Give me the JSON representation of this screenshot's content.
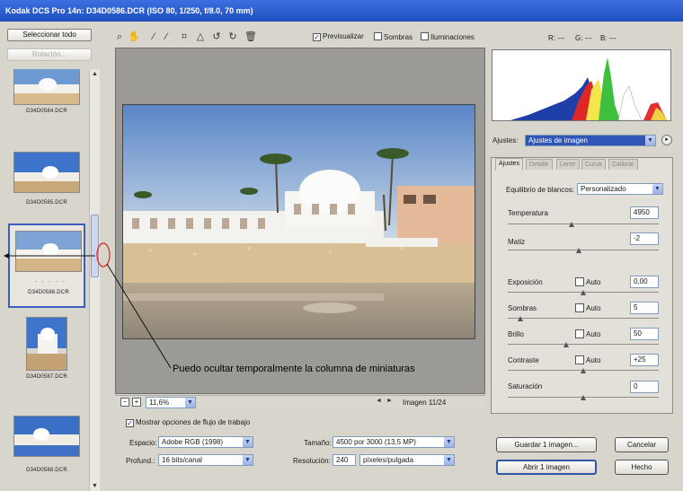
{
  "window": {
    "title": "Kodak DCS Pro 14n:  D34D0586.DCR  (ISO 80, 1/250, f/8.0, 70 mm)"
  },
  "sidebar": {
    "select_all": "Seleccionar todo",
    "rotate": "Rotación...",
    "thumbnails": [
      {
        "caption": "D34D0584.DCR"
      },
      {
        "caption": "D34D0585.DCR"
      },
      {
        "caption": "D34D0586.DCR",
        "dots": "- - - - -"
      },
      {
        "caption": "D34D0587.DCR"
      },
      {
        "caption": "D34D0588.DCR"
      }
    ]
  },
  "toolbar": {
    "preview_label": "Previsualizar",
    "preview_checked": true,
    "shadows_label": "Sombras",
    "highlights_label": "Iluminaciones",
    "tool_icons": [
      "zoom-icon",
      "hand-icon",
      "white-balance-eyedropper-icon",
      "color-sampler-icon",
      "crop-icon",
      "straighten-icon",
      "rotate-left-icon",
      "rotate-right-icon",
      "trash-icon"
    ]
  },
  "annotation": {
    "text": "Puedo ocultar temporalmente la columna de miniaturas"
  },
  "zoom": {
    "minus": "−",
    "plus": "+",
    "level": "11,6%",
    "prev": "◄",
    "next": "►",
    "image_counter": "Imagen 11/24"
  },
  "readout": {
    "r": "R: ---",
    "g": "G: ---",
    "b": "B: ---"
  },
  "settings": {
    "label": "Ajustes:",
    "value": "Ajustes de imagen"
  },
  "tabs": [
    "Ajustes",
    "Detalle",
    "Lente",
    "Curva",
    "Calibrar"
  ],
  "adjustments": {
    "wb_label": "Equilibrio de blancos:",
    "wb_value": "Personalizado",
    "temperature": {
      "label": "Temperatura",
      "value": "4950",
      "level": 0.42
    },
    "tint": {
      "label": "Matiz",
      "value": "-2",
      "level": 0.47
    },
    "exposure": {
      "label": "Exposición",
      "auto": "Auto",
      "value": "0,00",
      "level": 0.5
    },
    "shadows": {
      "label": "Sombras",
      "auto": "Auto",
      "value": "5",
      "level": 0.07
    },
    "brightness": {
      "label": "Brillo",
      "auto": "Auto",
      "value": "50",
      "level": 0.38
    },
    "contrast": {
      "label": "Contraste",
      "auto": "Auto",
      "value": "+25",
      "level": 0.5
    },
    "saturation": {
      "label": "Saturación",
      "value": "0",
      "level": 0.5
    }
  },
  "workflow": {
    "show_options_label": "Mostrar opciones de flujo de trabajo",
    "space_label": "Espacio:",
    "space_value": "Adobe RGB (1998)",
    "depth_label": "Profund.:",
    "depth_value": "16 bits/canal",
    "size_label": "Tamaño:",
    "size_value": "4500 por 3000 (13,5 MP)",
    "resolution_label": "Resolución:",
    "resolution_value": "240",
    "resolution_unit": "píxeles/pulgada"
  },
  "actions": {
    "save": "Guardar 1 imagen...",
    "cancel": "Cancelar",
    "open": "Abrir 1 imagen",
    "done": "Hecho"
  },
  "colors": {
    "title_bar": "#2858d0",
    "selection": "#3c5fbf",
    "annotation_circle": "#e02020"
  }
}
